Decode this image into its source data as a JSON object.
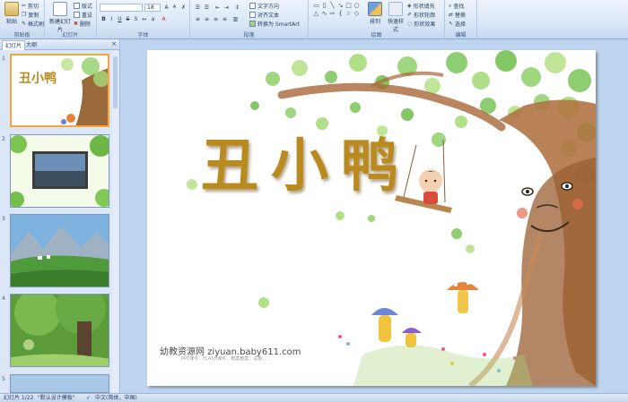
{
  "ribbon": {
    "clipboard": {
      "label": "剪贴板",
      "paste": "粘贴",
      "cut": "剪切",
      "copy": "复制",
      "painter": "格式刷"
    },
    "slides": {
      "label": "幻灯片",
      "new_slide": "新建幻灯片",
      "layout": "版式",
      "reset": "重设",
      "delete": "删除"
    },
    "font": {
      "label": "字体",
      "font_name": "",
      "font_size": "18"
    },
    "paragraph": {
      "label": "段落",
      "text_dir": "文字方向",
      "align_text": "对齐文本",
      "smartart": "转换为 SmartArt"
    },
    "drawing": {
      "label": "绘图",
      "arrange": "排列",
      "quick_styles": "快速样式",
      "fill": "形状填充",
      "outline": "形状轮廓",
      "effects": "形状效果"
    },
    "editing": {
      "label": "编辑",
      "find": "查找",
      "replace": "替换",
      "select": "选择"
    }
  },
  "panel": {
    "tab_slides": "幻灯片",
    "tab_outline": "大纲",
    "close": "×",
    "slide_numbers": [
      "1",
      "2",
      "3",
      "4",
      "5"
    ]
  },
  "slide": {
    "title": "丑小鸭",
    "watermark": "幼教资源网 ziyuan.baby611.com",
    "watermark_sub": "PPT课件、FLASH课件、教案教案、试卷……"
  },
  "status": {
    "slide_counter": "幻灯片 1/22",
    "theme": "\"默认设计模板\"",
    "language": "中文(简体，中国)"
  },
  "colors": {
    "accent": "#b98a1e",
    "ribbon": "#d6e4f5",
    "selection": "#f4a63b"
  }
}
